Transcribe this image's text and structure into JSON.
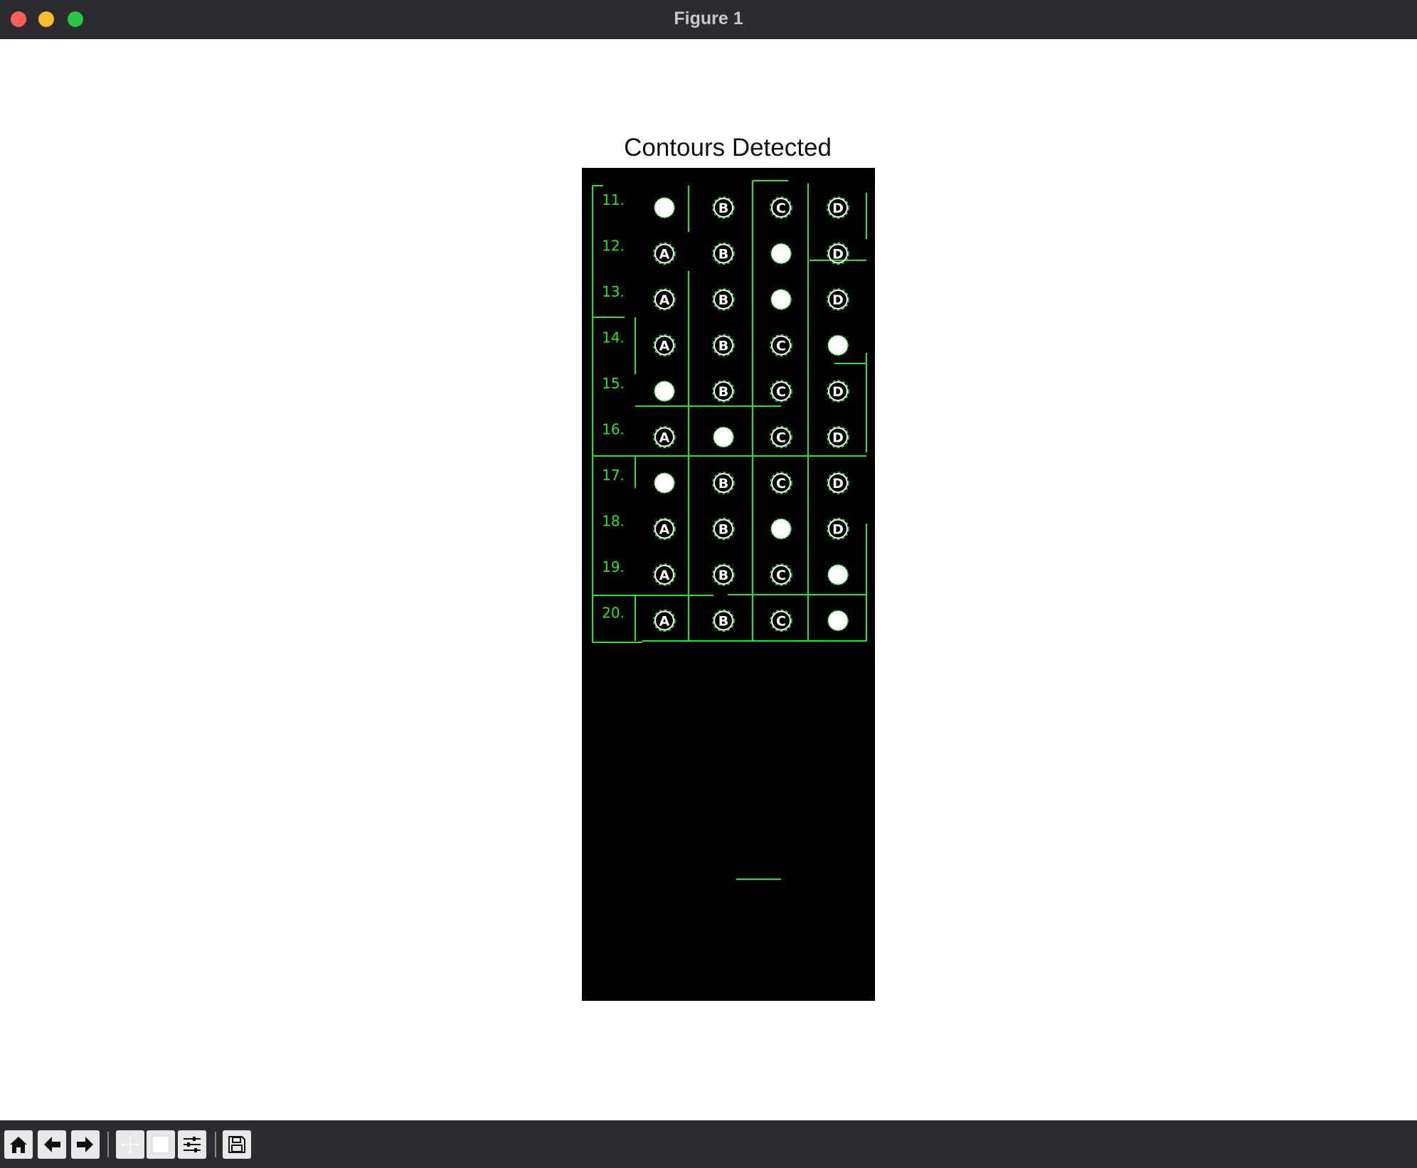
{
  "window": {
    "title": "Figure 1",
    "controls": [
      "close",
      "minimize",
      "maximize"
    ]
  },
  "figure": {
    "title": "Contours Detected"
  },
  "answer_sheet": {
    "contour_color": "#22e622",
    "options": [
      "A",
      "B",
      "C",
      "D"
    ],
    "rows": [
      {
        "number": "11.",
        "marked": "A"
      },
      {
        "number": "12.",
        "marked": "C"
      },
      {
        "number": "13.",
        "marked": "C"
      },
      {
        "number": "14.",
        "marked": "D"
      },
      {
        "number": "15.",
        "marked": "A"
      },
      {
        "number": "16.",
        "marked": "B"
      },
      {
        "number": "17.",
        "marked": "A"
      },
      {
        "number": "18.",
        "marked": "C"
      },
      {
        "number": "19.",
        "marked": "D"
      },
      {
        "number": "20.",
        "marked": "D"
      }
    ]
  },
  "toolbar": {
    "buttons": [
      {
        "name": "home-icon",
        "tooltip": "Home"
      },
      {
        "name": "back-arrow-icon",
        "tooltip": "Back"
      },
      {
        "name": "forward-arrow-icon",
        "tooltip": "Forward"
      },
      {
        "name": "pan-icon",
        "tooltip": "Pan"
      },
      {
        "name": "zoom-icon",
        "tooltip": "Zoom"
      },
      {
        "name": "configure-subplots-icon",
        "tooltip": "Configure subplots"
      },
      {
        "name": "save-icon",
        "tooltip": "Save"
      }
    ]
  }
}
